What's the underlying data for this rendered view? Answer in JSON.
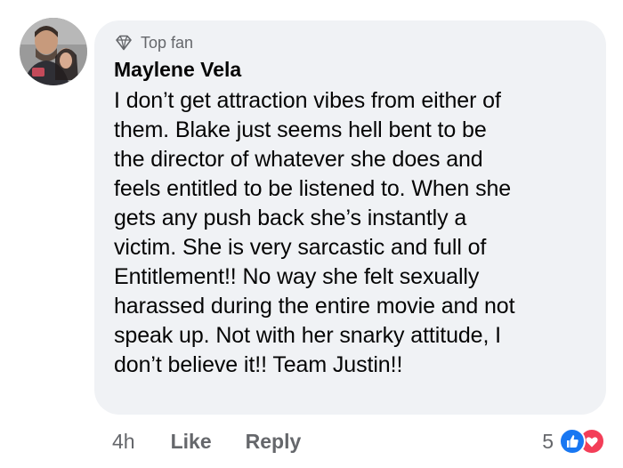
{
  "comment": {
    "badge_label": "Top fan",
    "author": "Maylene Vela",
    "lines": [
      "I don’t get attraction vibes from either of",
      "them. Blake just seems hell bent to be",
      "the director of whatever she does and",
      "feels entitled to be listened to. When she",
      "gets any push back she’s instantly a",
      "victim. She is very sarcastic and full of",
      "Entitlement!! No way she felt sexually",
      "harassed during the entire movie and not",
      "speak up. Not with her snarky attitude, I",
      "don’t believe it!! Team Justin!!"
    ]
  },
  "actions": {
    "timestamp": "4h",
    "like_label": "Like",
    "reply_label": "Reply"
  },
  "reactions": {
    "count": "5",
    "icons": [
      "like-reaction-icon",
      "love-reaction-icon"
    ],
    "like_color": "#1877f2",
    "love_color": "#f33e58"
  },
  "colors": {
    "bubble_bg": "#f0f2f5",
    "primary_text": "#050505",
    "secondary_text": "#65676b"
  }
}
